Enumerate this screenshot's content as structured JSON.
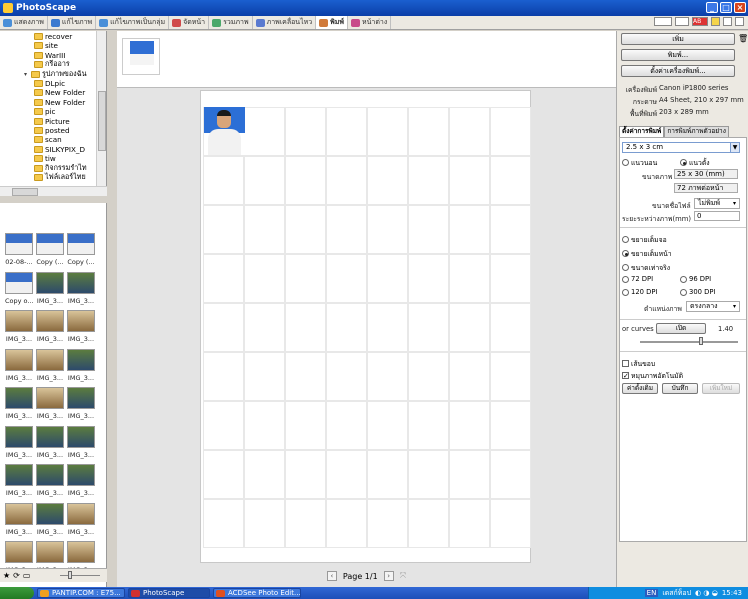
{
  "window": {
    "title": "PhotoScape"
  },
  "tabs": [
    {
      "label": "แสดงภาพ",
      "color": "#4a8fd8"
    },
    {
      "label": "แก้ไขภาพ",
      "color": "#3b7ad0"
    },
    {
      "label": "แก้ไขภาพเป็นกลุ่ม",
      "color": "#4a8fd8"
    },
    {
      "label": "จัดหน้า",
      "color": "#d04a4a"
    },
    {
      "label": "รวมภาพ",
      "color": "#4aa86a"
    },
    {
      "label": "ภาพเคลื่อนไหว",
      "color": "#5a7ad0"
    },
    {
      "label": "พิมพ์",
      "color": "#d07a3a",
      "active": true
    },
    {
      "label": "หน้าต่าง",
      "color": "#c84a8a"
    }
  ],
  "tree": [
    {
      "label": "recover",
      "level": 2
    },
    {
      "label": "site",
      "level": 2
    },
    {
      "label": "WarIII",
      "level": 2
    },
    {
      "label": "กรีออาร",
      "level": 2
    },
    {
      "label": "รูปภาพของฉัน",
      "level": 1,
      "expanded": true
    },
    {
      "label": "DLpic",
      "level": 2
    },
    {
      "label": "New Folder",
      "level": 2
    },
    {
      "label": "New Folder",
      "level": 2
    },
    {
      "label": "pic",
      "level": 2
    },
    {
      "label": "Picture",
      "level": 2
    },
    {
      "label": "posted",
      "level": 2
    },
    {
      "label": "scan",
      "level": 2
    },
    {
      "label": "SILKYPIX_D",
      "level": 2
    },
    {
      "label": "tiw",
      "level": 2
    },
    {
      "label": "กิจกรรมรำไท",
      "level": 2
    },
    {
      "label": "ไฟล์เลอร์ไทย",
      "level": 2
    }
  ],
  "thumbnails": [
    {
      "label": "02-08-...",
      "kind": "portrait"
    },
    {
      "label": "Copy (...",
      "kind": "portrait"
    },
    {
      "label": "Copy (...",
      "kind": "portrait"
    },
    {
      "label": "Copy o...",
      "kind": "portrait"
    },
    {
      "label": "IMG_3...",
      "kind": "class"
    },
    {
      "label": "IMG_3...",
      "kind": "class"
    },
    {
      "label": "IMG_3...",
      "kind": "room"
    },
    {
      "label": "IMG_3...",
      "kind": "room"
    },
    {
      "label": "IMG_3...",
      "kind": "room"
    },
    {
      "label": "IMG_3...",
      "kind": "room"
    },
    {
      "label": "IMG_3...",
      "kind": "room"
    },
    {
      "label": "IMG_3...",
      "kind": "class"
    },
    {
      "label": "IMG_3...",
      "kind": "class"
    },
    {
      "label": "IMG_3...",
      "kind": "room"
    },
    {
      "label": "IMG_3...",
      "kind": "class"
    },
    {
      "label": "IMG_3...",
      "kind": "class"
    },
    {
      "label": "IMG_3...",
      "kind": "class"
    },
    {
      "label": "IMG_3...",
      "kind": "class"
    },
    {
      "label": "IMG_3...",
      "kind": "class"
    },
    {
      "label": "IMG_3...",
      "kind": "class"
    },
    {
      "label": "IMG_3...",
      "kind": "class"
    },
    {
      "label": "IMG_3...",
      "kind": "room"
    },
    {
      "label": "IMG_3...",
      "kind": "class"
    },
    {
      "label": "IMG_3...",
      "kind": "room"
    },
    {
      "label": "IMG_3...",
      "kind": "room"
    },
    {
      "label": "IMG_3...",
      "kind": "room"
    },
    {
      "label": "IMG_3...",
      "kind": "room"
    },
    {
      "label": "IMG_3...",
      "kind": "class"
    },
    {
      "label": "IMG_3...",
      "kind": "class"
    },
    {
      "label": "IMG_3...",
      "kind": "class"
    }
  ],
  "pager": {
    "text": "Page 1/1"
  },
  "right": {
    "add_btn": "เพิ่ม",
    "print_btn": "พิมพ์...",
    "setup_btn": "ตั้งค่าเครื่องพิมพ์...",
    "printer_label": "เครื่องพิมพ์",
    "printer_value": "Canon iP1800 series",
    "paper_label": "กระดาษ",
    "paper_value": "A4 Sheet, 210 x 297 mm",
    "area_label": "พื้นที่พิมพ์",
    "area_value": "203 x 289 mm",
    "tab1": "ตั้งค่าการพิมพ์",
    "tab2": "การพิมพ์ภาพตัวอย่าง",
    "size_select": "2.5 x 3 cm",
    "landscape": "แนวนอน",
    "portrait": "แนวตั้ง",
    "imgsize_label": "ขนาดภาพ",
    "imgsize_value": "25 x 30 (mm)",
    "perpage_value": "72 ภาพต่อหน้า",
    "font_label": "ขนาดชื่อไฟล์",
    "font_value": "ไม่พิมพ์",
    "gap_label": "ระยะระหว่างภาพ(mm)",
    "gap_value": "0",
    "fit_full": "ขยายเต็มจอ",
    "fit_page": "ขยายเต็มหน้า",
    "actual": "ขนาดเท่าจริง",
    "dpi72": "72 DPI",
    "dpi96": "96 DPI",
    "dpi120": "120 DPI",
    "dpi300": "300 DPI",
    "pos_label": "ตำแหน่งภาพ",
    "pos_value": "ตรงกลาง",
    "curves_label": "or curves",
    "curves_btn": "เปิด",
    "curves_value": "1.40",
    "border_cb": "เส้นขอบ",
    "rotate_cb": "หมุนภาพอัตโนมัติ",
    "b1": "ค่าดั้งเดิม",
    "b2": "บันทึก",
    "b3": "เพิ่มใหม่"
  },
  "taskbar": {
    "tasks": [
      "PANTIP.COM : E75...",
      "PhotoScape",
      "ACDSee Photo Edit..."
    ],
    "lang": "EN",
    "tray_text": "เดสก์ท็อป",
    "clock": "15:43"
  }
}
